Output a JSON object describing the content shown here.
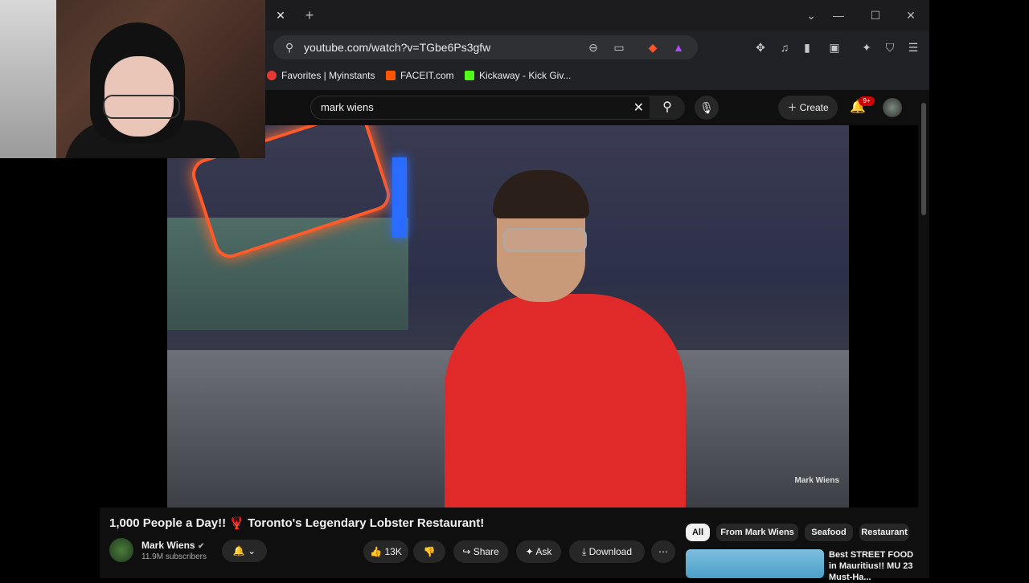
{
  "browser": {
    "tab_close": "✕",
    "new_tab": "+",
    "url": "youtube.com/watch?v=TGbe6Ps3gfw",
    "bookmarks": [
      {
        "label": "Favorites | Myinstants",
        "color": "#e53935"
      },
      {
        "label": "FACEIT.com",
        "color": "#ff5500"
      },
      {
        "label": "Kickaway - Kick Giv...",
        "color": "#53fc18"
      }
    ],
    "window_controls": [
      "⌄",
      "—",
      "☐",
      "✕"
    ]
  },
  "youtube": {
    "search_value": "mark wiens",
    "create_label": "Create",
    "notifications_badge": "9+",
    "video": {
      "watermark": "Mark Wiens",
      "title": "1,000 People a Day!! 🦞 Toronto's Legendary Lobster Restaurant!",
      "channel_name": "Mark Wiens",
      "verified": "✔",
      "subscribers": "11.9M subscribers",
      "likes": "13K",
      "share_label": "Share",
      "ask_label": "Ask",
      "download_label": "Download",
      "more_label": "⋯"
    },
    "chips": [
      "All",
      "From Mark Wiens",
      "Seafood",
      "Restaurant"
    ],
    "recommended": {
      "title": "Best STREET FOOD in Mauritius!! MU 23 Must-Ha..."
    }
  }
}
